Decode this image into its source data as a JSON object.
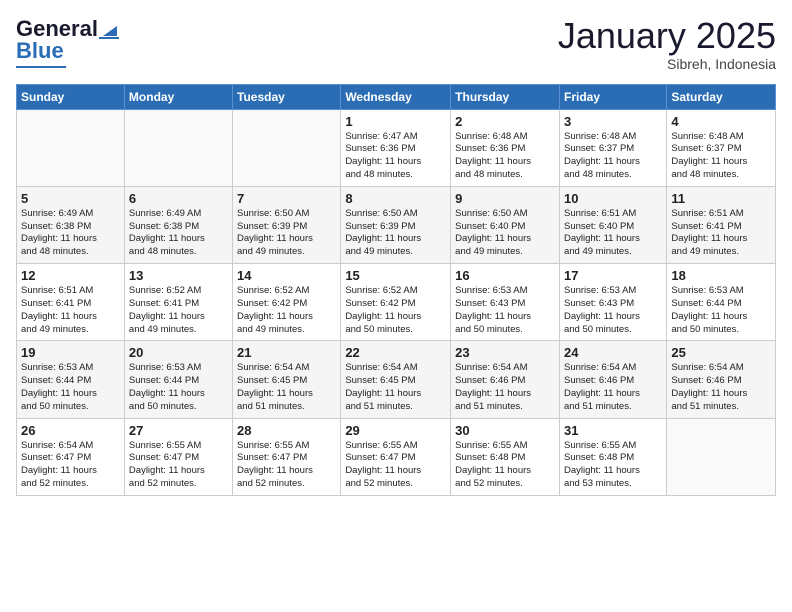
{
  "logo": {
    "line1": "General",
    "line2": "Blue"
  },
  "title": "January 2025",
  "subtitle": "Sibreh, Indonesia",
  "header_days": [
    "Sunday",
    "Monday",
    "Tuesday",
    "Wednesday",
    "Thursday",
    "Friday",
    "Saturday"
  ],
  "weeks": [
    [
      {
        "day": "",
        "info": ""
      },
      {
        "day": "",
        "info": ""
      },
      {
        "day": "",
        "info": ""
      },
      {
        "day": "1",
        "info": "Sunrise: 6:47 AM\nSunset: 6:36 PM\nDaylight: 11 hours\nand 48 minutes."
      },
      {
        "day": "2",
        "info": "Sunrise: 6:48 AM\nSunset: 6:36 PM\nDaylight: 11 hours\nand 48 minutes."
      },
      {
        "day": "3",
        "info": "Sunrise: 6:48 AM\nSunset: 6:37 PM\nDaylight: 11 hours\nand 48 minutes."
      },
      {
        "day": "4",
        "info": "Sunrise: 6:48 AM\nSunset: 6:37 PM\nDaylight: 11 hours\nand 48 minutes."
      }
    ],
    [
      {
        "day": "5",
        "info": "Sunrise: 6:49 AM\nSunset: 6:38 PM\nDaylight: 11 hours\nand 48 minutes."
      },
      {
        "day": "6",
        "info": "Sunrise: 6:49 AM\nSunset: 6:38 PM\nDaylight: 11 hours\nand 48 minutes."
      },
      {
        "day": "7",
        "info": "Sunrise: 6:50 AM\nSunset: 6:39 PM\nDaylight: 11 hours\nand 49 minutes."
      },
      {
        "day": "8",
        "info": "Sunrise: 6:50 AM\nSunset: 6:39 PM\nDaylight: 11 hours\nand 49 minutes."
      },
      {
        "day": "9",
        "info": "Sunrise: 6:50 AM\nSunset: 6:40 PM\nDaylight: 11 hours\nand 49 minutes."
      },
      {
        "day": "10",
        "info": "Sunrise: 6:51 AM\nSunset: 6:40 PM\nDaylight: 11 hours\nand 49 minutes."
      },
      {
        "day": "11",
        "info": "Sunrise: 6:51 AM\nSunset: 6:41 PM\nDaylight: 11 hours\nand 49 minutes."
      }
    ],
    [
      {
        "day": "12",
        "info": "Sunrise: 6:51 AM\nSunset: 6:41 PM\nDaylight: 11 hours\nand 49 minutes."
      },
      {
        "day": "13",
        "info": "Sunrise: 6:52 AM\nSunset: 6:41 PM\nDaylight: 11 hours\nand 49 minutes."
      },
      {
        "day": "14",
        "info": "Sunrise: 6:52 AM\nSunset: 6:42 PM\nDaylight: 11 hours\nand 49 minutes."
      },
      {
        "day": "15",
        "info": "Sunrise: 6:52 AM\nSunset: 6:42 PM\nDaylight: 11 hours\nand 50 minutes."
      },
      {
        "day": "16",
        "info": "Sunrise: 6:53 AM\nSunset: 6:43 PM\nDaylight: 11 hours\nand 50 minutes."
      },
      {
        "day": "17",
        "info": "Sunrise: 6:53 AM\nSunset: 6:43 PM\nDaylight: 11 hours\nand 50 minutes."
      },
      {
        "day": "18",
        "info": "Sunrise: 6:53 AM\nSunset: 6:44 PM\nDaylight: 11 hours\nand 50 minutes."
      }
    ],
    [
      {
        "day": "19",
        "info": "Sunrise: 6:53 AM\nSunset: 6:44 PM\nDaylight: 11 hours\nand 50 minutes."
      },
      {
        "day": "20",
        "info": "Sunrise: 6:53 AM\nSunset: 6:44 PM\nDaylight: 11 hours\nand 50 minutes."
      },
      {
        "day": "21",
        "info": "Sunrise: 6:54 AM\nSunset: 6:45 PM\nDaylight: 11 hours\nand 51 minutes."
      },
      {
        "day": "22",
        "info": "Sunrise: 6:54 AM\nSunset: 6:45 PM\nDaylight: 11 hours\nand 51 minutes."
      },
      {
        "day": "23",
        "info": "Sunrise: 6:54 AM\nSunset: 6:46 PM\nDaylight: 11 hours\nand 51 minutes."
      },
      {
        "day": "24",
        "info": "Sunrise: 6:54 AM\nSunset: 6:46 PM\nDaylight: 11 hours\nand 51 minutes."
      },
      {
        "day": "25",
        "info": "Sunrise: 6:54 AM\nSunset: 6:46 PM\nDaylight: 11 hours\nand 51 minutes."
      }
    ],
    [
      {
        "day": "26",
        "info": "Sunrise: 6:54 AM\nSunset: 6:47 PM\nDaylight: 11 hours\nand 52 minutes."
      },
      {
        "day": "27",
        "info": "Sunrise: 6:55 AM\nSunset: 6:47 PM\nDaylight: 11 hours\nand 52 minutes."
      },
      {
        "day": "28",
        "info": "Sunrise: 6:55 AM\nSunset: 6:47 PM\nDaylight: 11 hours\nand 52 minutes."
      },
      {
        "day": "29",
        "info": "Sunrise: 6:55 AM\nSunset: 6:47 PM\nDaylight: 11 hours\nand 52 minutes."
      },
      {
        "day": "30",
        "info": "Sunrise: 6:55 AM\nSunset: 6:48 PM\nDaylight: 11 hours\nand 52 minutes."
      },
      {
        "day": "31",
        "info": "Sunrise: 6:55 AM\nSunset: 6:48 PM\nDaylight: 11 hours\nand 53 minutes."
      },
      {
        "day": "",
        "info": ""
      }
    ]
  ]
}
